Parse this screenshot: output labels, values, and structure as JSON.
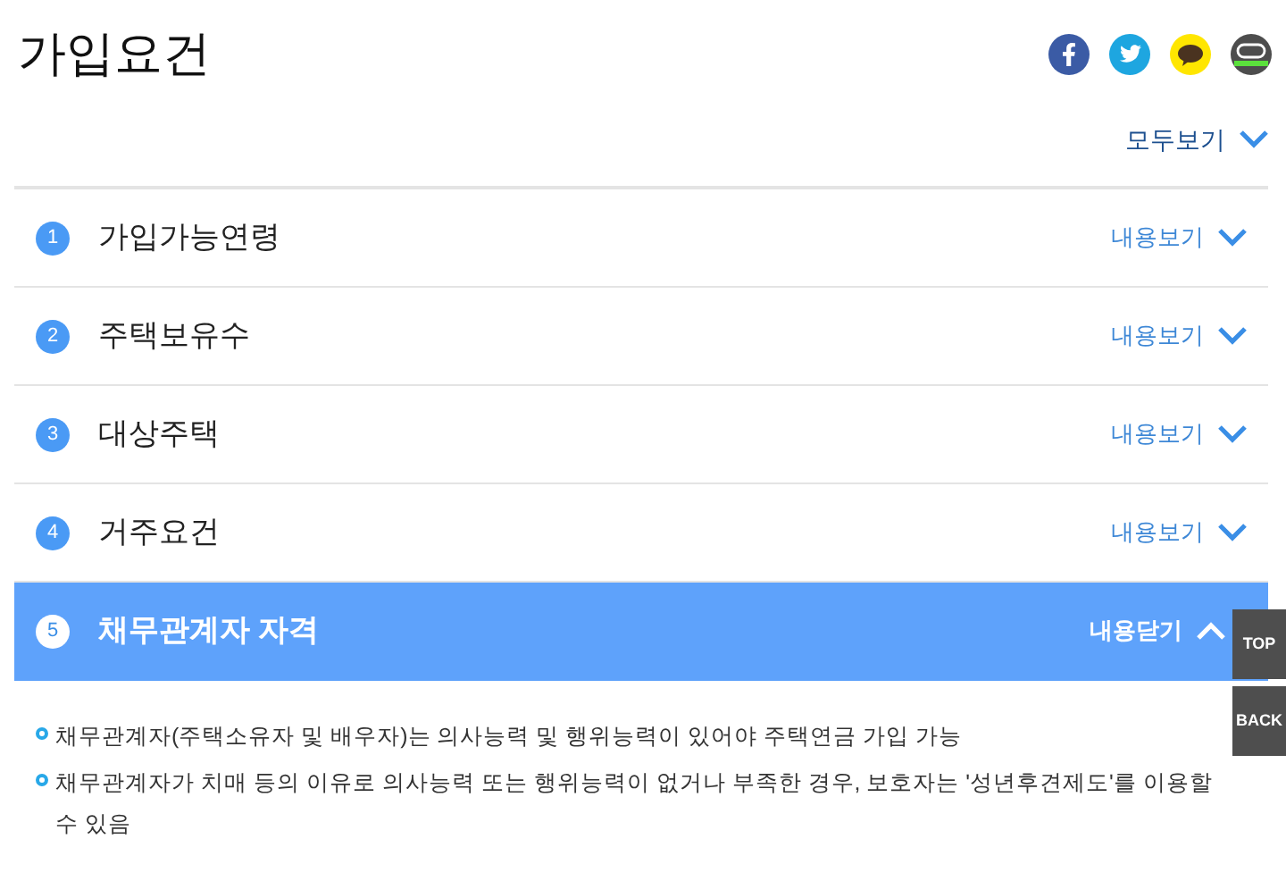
{
  "title": "가입요건",
  "show_all": "모두보기",
  "items": [
    {
      "number": "1",
      "title": "가입가능연령",
      "toggle": "내용보기",
      "expanded": false
    },
    {
      "number": "2",
      "title": "주택보유수",
      "toggle": "내용보기",
      "expanded": false
    },
    {
      "number": "3",
      "title": "대상주택",
      "toggle": "내용보기",
      "expanded": false
    },
    {
      "number": "4",
      "title": "거주요건",
      "toggle": "내용보기",
      "expanded": false
    },
    {
      "number": "5",
      "title": "채무관계자 자격",
      "toggle": "내용닫기",
      "expanded": true,
      "content": [
        "채무관계자(주택소유자 및 배우자)는 의사능력 및 행위능력이 있어야 주택연금 가입 가능",
        "채무관계자가 치매 등의 이유로 의사능력 또는 행위능력이 없거나 부족한 경우, 보호자는 '성년후견제도'를 이용할 수 있음"
      ]
    }
  ],
  "float_buttons": [
    "TOP",
    "BACK"
  ]
}
